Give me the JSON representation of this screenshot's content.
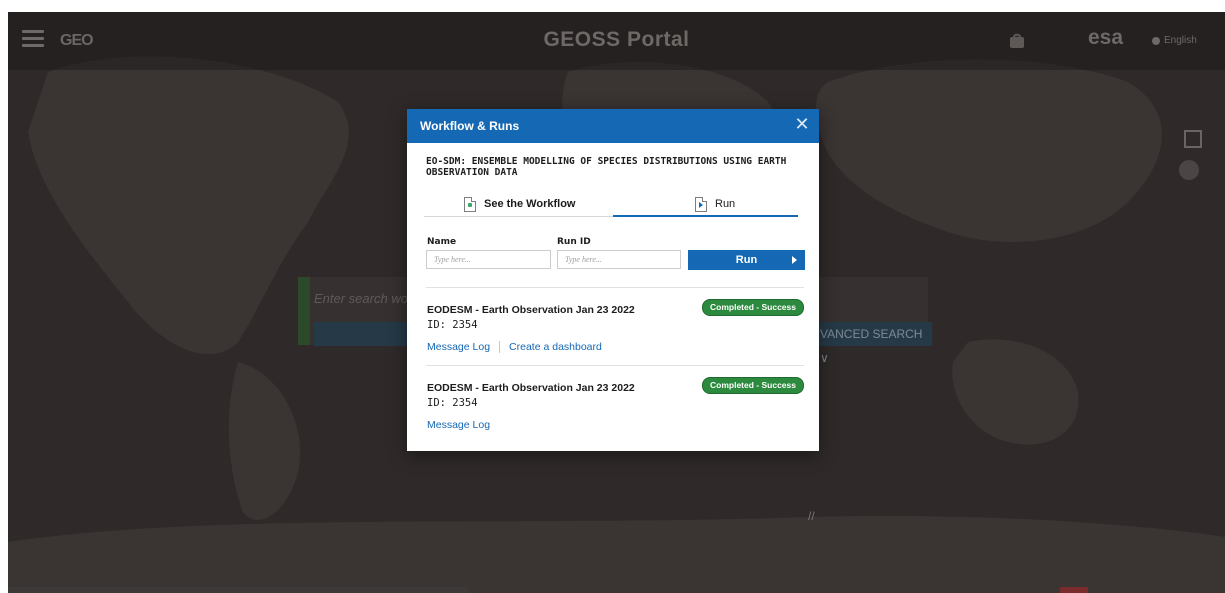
{
  "background": {
    "portal_title": "GEOSS Portal",
    "geo_logo": "GEO",
    "esa_logo": "esa",
    "language": "English",
    "search_placeholder": "Enter search wo",
    "advanced_search": "VANCED SEARCH ∨",
    "hamburger_icon": "hamburger-icon"
  },
  "modal": {
    "title": "Workflow & Runs",
    "close_symbol": "✕",
    "workflow_name": "EO-SDM: ENSEMBLE MODELLING OF SPECIES DISTRIBUTIONS USING EARTH OBSERVATION DATA",
    "tabs": [
      {
        "label": "See the Workflow",
        "icon": "workflow-doc-icon",
        "active": false
      },
      {
        "label": "Run",
        "icon": "run-doc-icon",
        "active": true
      }
    ],
    "form": {
      "name_label": "Name",
      "name_placeholder": "Type here...",
      "runid_label": "Run ID",
      "runid_placeholder": "Type here...",
      "run_button": "Run"
    },
    "runs": [
      {
        "title": "EODESM - Earth Observation Jan 23 2022",
        "id": "ID: 2354",
        "status": "Completed - Success",
        "links": [
          "Message Log",
          "Create a dashboard"
        ]
      },
      {
        "title": "EODESM - Earth Observation Jan 23 2022",
        "id": "ID: 2354",
        "status": "Completed - Success",
        "links": [
          "Message Log"
        ]
      }
    ]
  },
  "colors": {
    "primary": "#1568b4",
    "success": "#2b8a3e",
    "overlay_bg": "#2f2a29"
  }
}
